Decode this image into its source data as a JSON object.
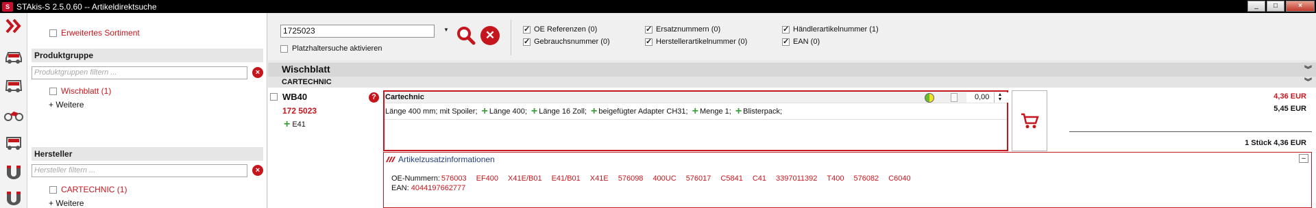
{
  "window": {
    "logo_text": "S",
    "title": "STAkis-S 2.5.0.60  --  Artikeldirektsuche",
    "minimize": "_",
    "maximize": "□",
    "close": "×"
  },
  "sidebar": {
    "items": [
      {
        "icon": "chevron-right-double-icon"
      },
      {
        "icon": "car-icon"
      },
      {
        "icon": "van-icon"
      },
      {
        "icon": "motorcycle-icon"
      },
      {
        "icon": "truck-icon"
      },
      {
        "icon": "magnet-parts-icon"
      },
      {
        "icon": "magnet-tools-icon"
      }
    ]
  },
  "filters": {
    "extended_assortment_label": "Erweitertes Sortiment",
    "product_group": {
      "title": "Produktgruppe",
      "placeholder": "Produktgruppen filtern ...",
      "items": [
        {
          "label": "Wischblatt (1)",
          "checked": false
        }
      ],
      "more_label": "+ Weitere"
    },
    "manufacturer": {
      "title": "Hersteller",
      "placeholder": "Hersteller filtern ...",
      "items": [
        {
          "label": "CARTECHNIC (1)",
          "checked": false
        }
      ],
      "more_label": "+ Weitere"
    }
  },
  "search": {
    "value": "1725023",
    "wildcard_label": "Platzhaltersuche aktivieren",
    "options": [
      {
        "label": "OE Referenzen (0)",
        "checked": true
      },
      {
        "label": "Gebrauchsnummer (0)",
        "checked": true
      },
      {
        "label": "Ersatznummern (0)",
        "checked": true
      },
      {
        "label": "Herstellerartikelnummer (0)",
        "checked": true
      },
      {
        "label": "Händlerartikelnummer (1)",
        "checked": true
      },
      {
        "label": "EAN (0)",
        "checked": true
      }
    ]
  },
  "results": {
    "group_title": "Wischblatt",
    "brand_title": "CARTECHNIC",
    "article": {
      "name": "WB40",
      "number": "172 5023",
      "ean_ref": "E41",
      "detail_title": "Cartechnic",
      "quantity": "0,00",
      "description_first": "Länge 400 mm; mit Spoiler;",
      "criteria": [
        "Länge 400;",
        "Länge 16 Zoll;",
        "beigefügter Adapter CH31;",
        "Menge 1;",
        "Blisterpack;"
      ],
      "price_red": "4,36 EUR",
      "price_black": "5,45 EUR",
      "unit_price": "1 Stück 4,36 EUR",
      "colors": {
        "availability_left": "#6cbc29",
        "availability_right": "#f0e12a",
        "accent": "#c4161c"
      }
    },
    "info": {
      "title": "Artikelzusatzinformationen",
      "collapse": "–",
      "oe_label": "OE-Nummern:",
      "oe_numbers": [
        "576003",
        "EF400",
        "X41E/B01",
        "E41/B01",
        "X41E",
        "576098",
        "400UC",
        "576017",
        "C5841",
        "C41",
        "3397011392",
        "T400",
        "576082",
        "C6040"
      ],
      "ean_label": "EAN:",
      "ean_value": "4044197662777"
    }
  }
}
